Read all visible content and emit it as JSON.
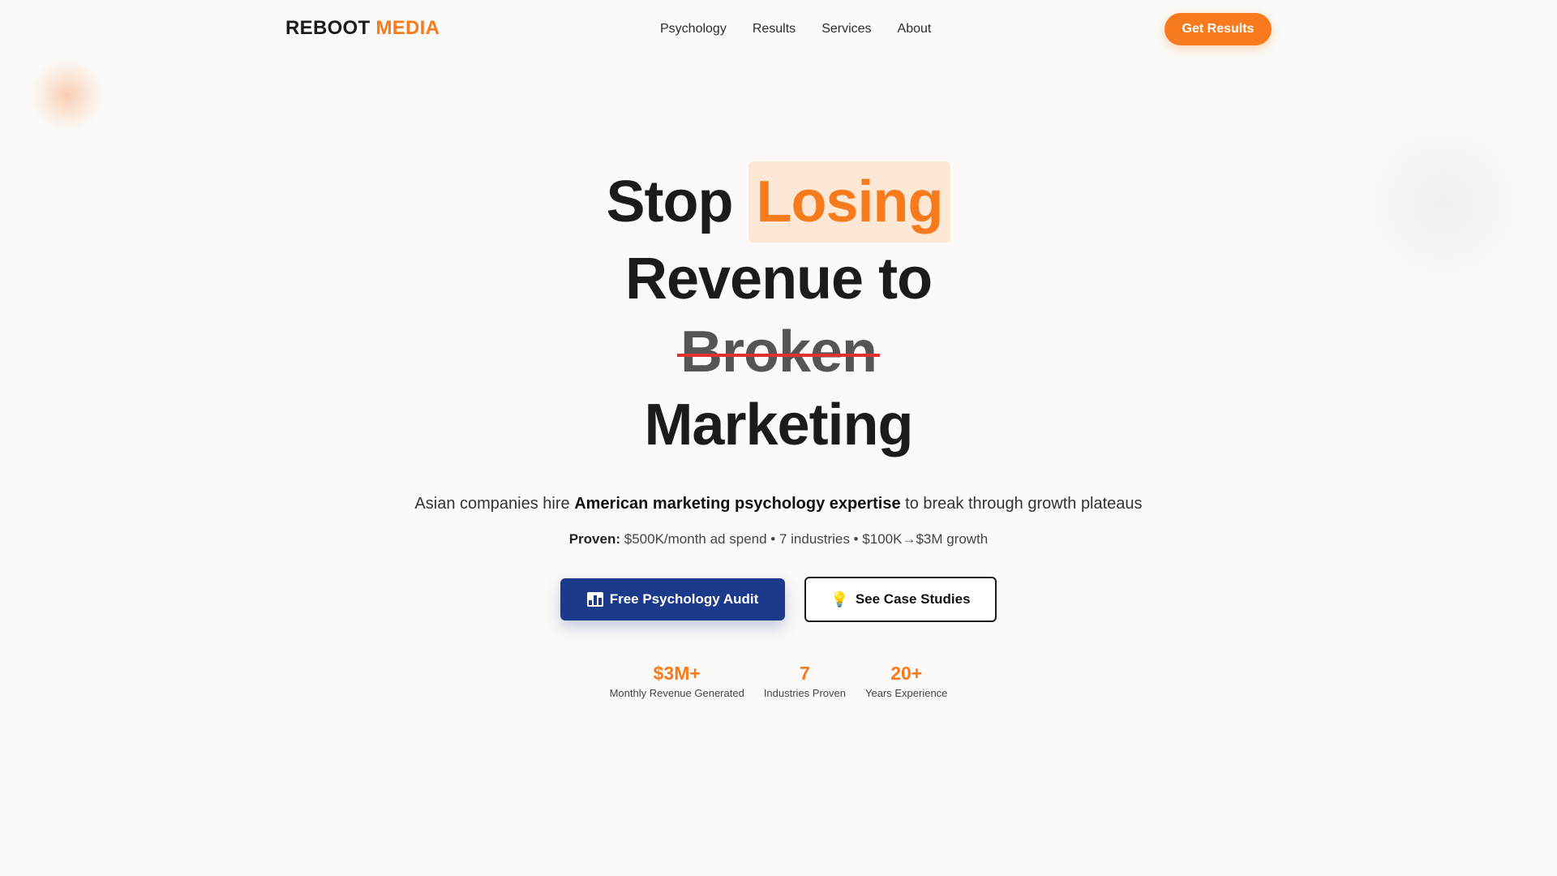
{
  "nav": {
    "logo_main": "REBOOT",
    "logo_accent": "MEDIA",
    "items": [
      "Psychology",
      "Results",
      "Services",
      "About"
    ],
    "cta": "Get Results"
  },
  "hero": {
    "line1_a": "Stop",
    "line1_highlight": "Losing",
    "line2": "Revenue to",
    "line3_strike": "Broken",
    "line4": "Marketing",
    "subtitle_pre": "Asian companies hire",
    "subtitle_bold": "American marketing psychology expertise",
    "subtitle_post": "to break through growth plateaus",
    "proof_label": "Proven:",
    "proof_text": "$500K/month ad spend • 7 industries • $100K→$3M growth"
  },
  "buttons": {
    "primary_label": "Free Psychology Audit",
    "secondary_label": "See Case Studies"
  },
  "stats": [
    {
      "value": "$3M+",
      "label": "Monthly Revenue Generated"
    },
    {
      "value": "7",
      "label": "Industries Proven"
    },
    {
      "value": "20+",
      "label": "Years Experience"
    }
  ],
  "colors": {
    "accent": "#f77a1c",
    "primary_button": "#1c3a8c",
    "strike": "#e0312f",
    "highlight_bg": "#fde8d6"
  },
  "icons": {
    "primary_button_icon": "bar-chart-icon",
    "secondary_button_icon": "light-bulb-icon"
  }
}
